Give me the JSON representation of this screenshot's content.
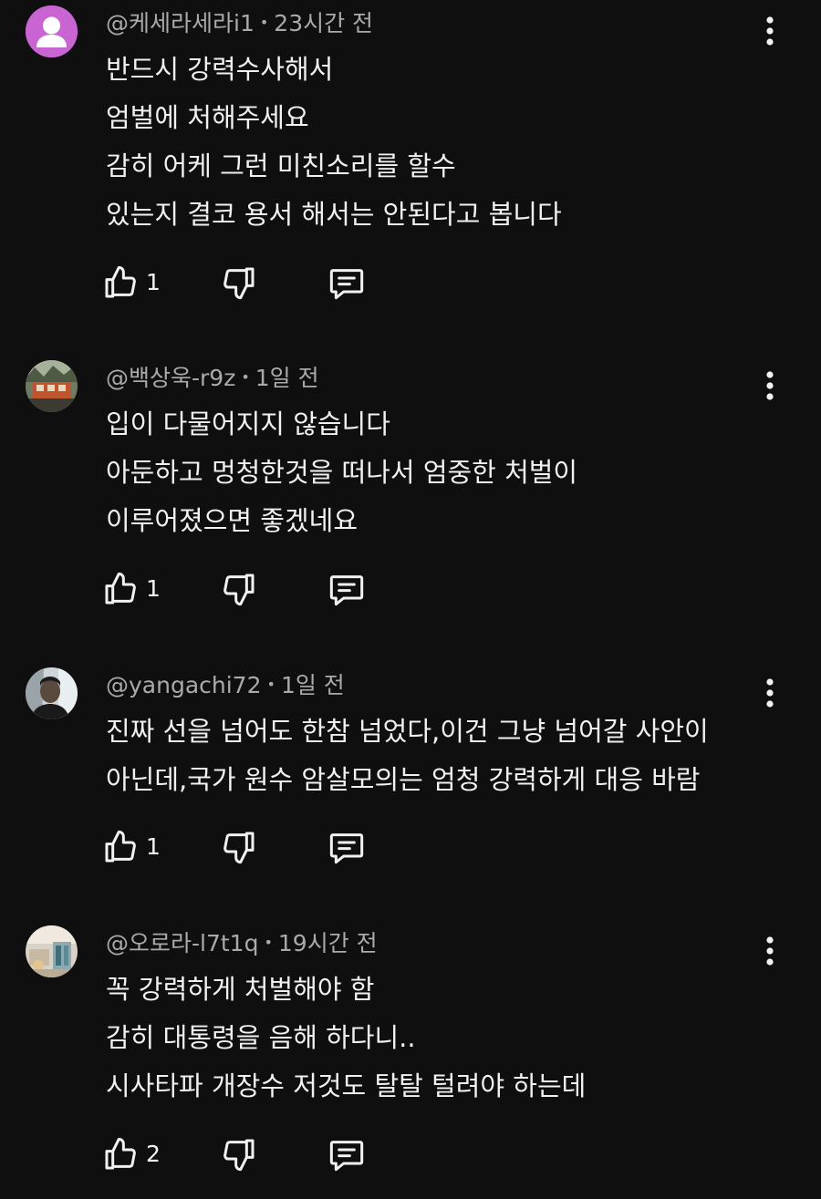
{
  "comments": [
    {
      "author": "@케세라세라i1",
      "time": "23시간 전",
      "avatar": "default-avatar",
      "lines": [
        "반드시 강력수사해서",
        "엄벌에 처해주세요",
        "감히 어케 그런 미친소리를 할수",
        "있는지 결코 용서 해서는 안된다고 봅니다"
      ],
      "likes": "1"
    },
    {
      "author": "@백상욱-r9z",
      "time": "1일 전",
      "avatar": "building-photo-avatar",
      "lines": [
        "입이 다물어지지 않습니다",
        "아둔하고 멍청한것을 떠나서 엄중한 처벌이",
        "이루어졌으면 좋겠네요"
      ],
      "likes": "1"
    },
    {
      "author": "@yangachi72",
      "time": "1일 전",
      "avatar": "person-photo-avatar",
      "lines": [
        "진짜 선을 넘어도 한참 넘었다,이건 그냥 넘어갈 사안이",
        "아닌데,국가 원수 암살모의는 엄청 강력하게 대응 바람"
      ],
      "likes": "1"
    },
    {
      "author": "@오로라-l7t1q",
      "time": "19시간 전",
      "avatar": "room-photo-avatar",
      "lines": [
        "꼭 강력하게 처벌해야 함",
        "감히 대통령을 음해 하다니..",
        "시사타파 개장수 저것도 탈탈 털려야 하는데"
      ],
      "likes": "2"
    }
  ],
  "separator": "•",
  "icons": {
    "like": "thumbs-up-icon",
    "dislike": "thumbs-down-icon",
    "reply": "reply-comment-icon",
    "more": "more-vertical-icon"
  },
  "colors": {
    "background": "#0f0f0f",
    "text": "#f1f1f1",
    "meta": "#aaaaaa",
    "default_avatar": "#c964d3"
  }
}
